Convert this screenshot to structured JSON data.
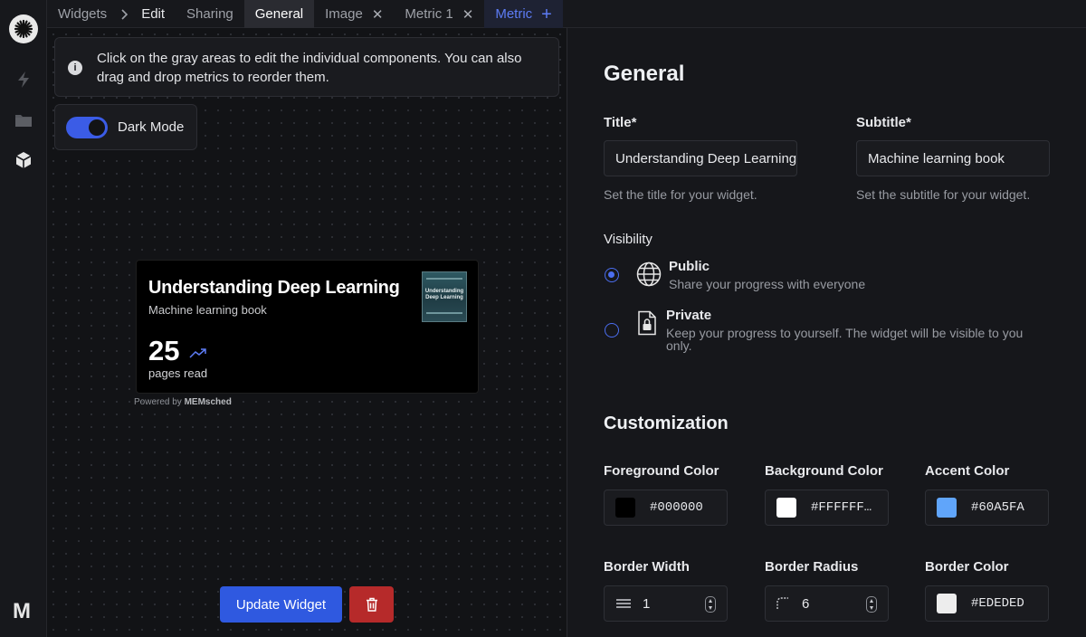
{
  "tabs": {
    "widgets": "Widgets",
    "edit": "Edit",
    "sharing": "Sharing",
    "general": "General",
    "image": "Image",
    "metric1": "Metric 1",
    "metric": "Metric"
  },
  "canvas": {
    "notice": "Click on the gray areas to edit the individual components. You can also drag and drop metrics to reorder them.",
    "dark_mode_label": "Dark Mode",
    "dark_mode_on": true,
    "widget": {
      "title": "Understanding Deep Learning",
      "subtitle": "Machine learning book",
      "cover_text": "Understanding Deep Learning",
      "metric_value": "25",
      "metric_unit": "pages read"
    },
    "powered_by": "Powered by",
    "powered_brand": "MEMsched",
    "update_button": "Update Widget"
  },
  "general": {
    "heading": "General",
    "title_label": "Title*",
    "title_value": "Understanding Deep Learning",
    "title_hint": "Set the title for your widget.",
    "subtitle_label": "Subtitle*",
    "subtitle_value": "Machine learning book",
    "subtitle_hint": "Set the subtitle for your widget.",
    "visibility_label": "Visibility",
    "public_title": "Public",
    "public_desc": "Share your progress with everyone",
    "private_title": "Private",
    "private_desc": "Keep your progress to yourself. The widget will be visible to you only.",
    "selected": "Public"
  },
  "customization": {
    "heading": "Customization",
    "foreground_label": "Foreground Color",
    "foreground_value": "#000000",
    "background_label": "Background Color",
    "background_value": "#FFFFFF…",
    "accent_label": "Accent Color",
    "accent_value": "#60A5FA",
    "border_width_label": "Border Width",
    "border_width_value": "1",
    "border_radius_label": "Border Radius",
    "border_radius_value": "6",
    "border_color_label": "Border Color",
    "border_color_value": "#EDEDED"
  },
  "colors": {
    "foreground": "#000000",
    "background": "#FFFFFF",
    "accent": "#60A5FA",
    "border": "#EDEDED",
    "primary_button": "#2F59E0",
    "danger_button": "#B62A2A"
  },
  "icons": [
    "burst-logo-icon",
    "lightning-icon",
    "folder-icon",
    "cube-icon",
    "m-brand-icon",
    "chevron-right-icon",
    "close-icon",
    "plus-icon",
    "info-icon",
    "trend-up-icon",
    "trash-icon",
    "globe-icon",
    "lock-document-icon",
    "lines-icon",
    "corner-radius-icon",
    "stepper-icon"
  ]
}
